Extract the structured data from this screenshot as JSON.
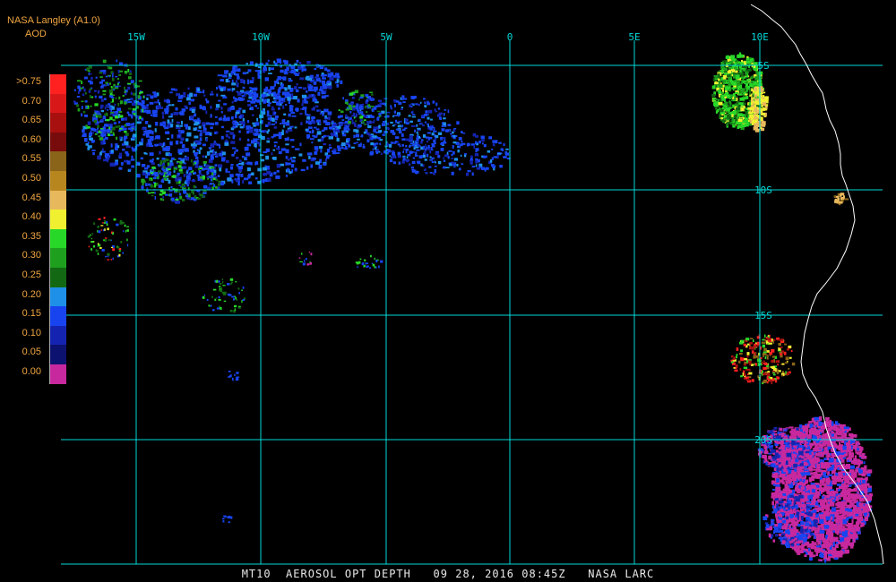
{
  "header": {
    "brand": "NASA Langley (A1.0)",
    "product": "AOD"
  },
  "colors": {
    "background": "#000000",
    "grid": "#00d8d8",
    "coast": "#ffffff",
    "header_text": "#f0a640",
    "footer_text": "#e8e8e8"
  },
  "legend": {
    "items": [
      {
        "label": ">0.75",
        "color": "#ff2020"
      },
      {
        "label": "0.70",
        "color": "#d81818"
      },
      {
        "label": "0.65",
        "color": "#a81010"
      },
      {
        "label": "0.60",
        "color": "#780c0c"
      },
      {
        "label": "0.55",
        "color": "#8a6418"
      },
      {
        "label": "0.50",
        "color": "#b8861e"
      },
      {
        "label": "0.45",
        "color": "#e8b85c"
      },
      {
        "label": "0.40",
        "color": "#f0f030"
      },
      {
        "label": "0.35",
        "color": "#28d828"
      },
      {
        "label": "0.30",
        "color": "#1ea01e"
      },
      {
        "label": "0.25",
        "color": "#136813"
      },
      {
        "label": "0.20",
        "color": "#1e90e8"
      },
      {
        "label": "0.15",
        "color": "#1844f0"
      },
      {
        "label": "0.10",
        "color": "#1424b0"
      },
      {
        "label": "0.05",
        "color": "#0c1270"
      },
      {
        "label": "0.00",
        "color": "#c8289e"
      }
    ]
  },
  "grid": {
    "lon_labels": [
      "15W",
      "10W",
      "5W",
      "0",
      "5E",
      "10E"
    ],
    "lat_labels": [
      "5S",
      "10S",
      "15S",
      "20S"
    ]
  },
  "footer": {
    "text": "MT10  AEROSOL OPT DEPTH   09 28, 2016 08:45Z   NASA LARC"
  }
}
